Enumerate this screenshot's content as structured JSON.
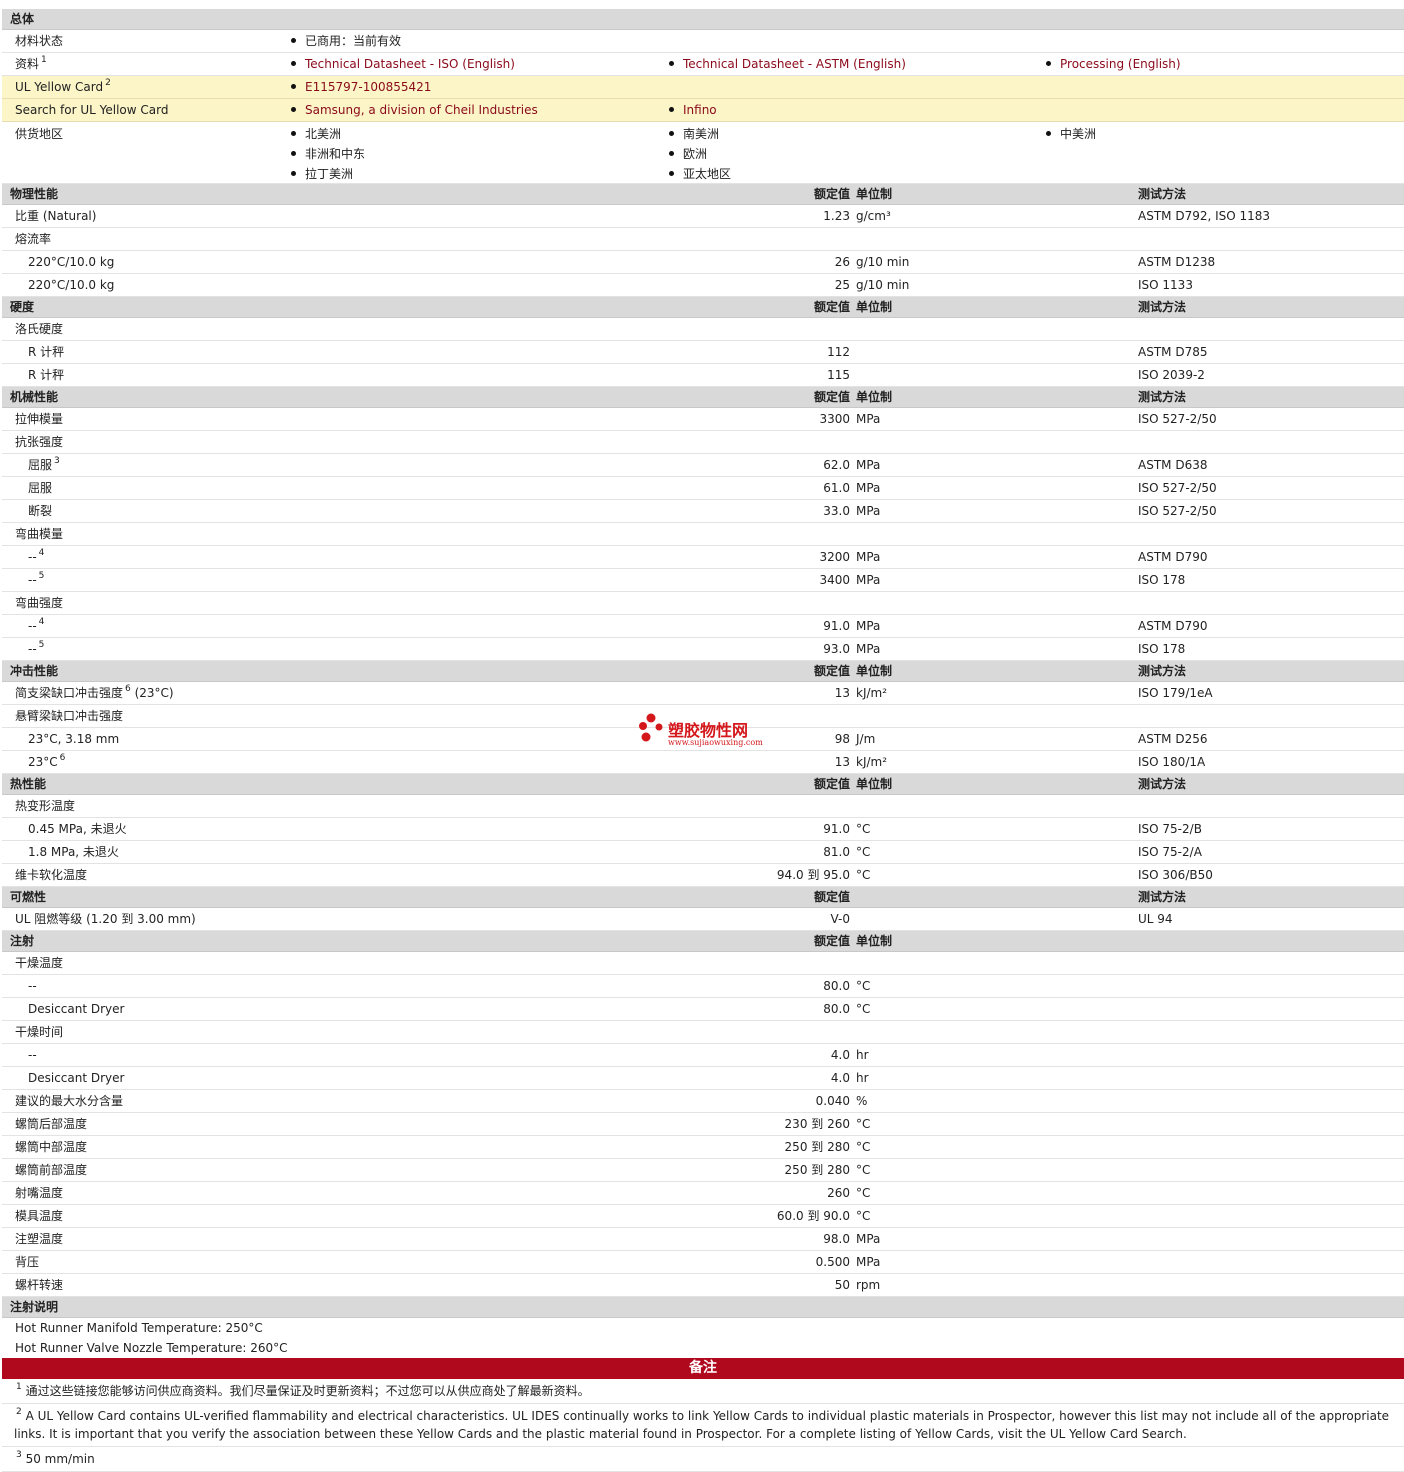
{
  "general": {
    "title": "总体",
    "material_status_label": "材料状态",
    "material_status_value": "已商用：当前有效",
    "docs_label": "资料",
    "docs_sup": "1",
    "docs": [
      "Technical Datasheet - ISO (English)",
      "Technical Datasheet - ASTM (English)",
      "Processing (English)"
    ],
    "ulcard_label": "UL Yellow Card",
    "ulcard_sup": "2",
    "ulcard_value": "E115797-100855421",
    "search_label": "Search for UL Yellow Card",
    "search_values": [
      "Samsung, a division of Cheil Industries",
      "Infino"
    ],
    "supply_label": "供货地区",
    "supply_col1": [
      "北美洲",
      "非洲和中东",
      "拉丁美洲"
    ],
    "supply_col2": [
      "南美洲",
      "欧洲",
      "亚太地区"
    ],
    "supply_col3": [
      "中美洲"
    ]
  },
  "headers": {
    "nominal": "额定值",
    "unit": "单位制",
    "method": "测试方法"
  },
  "physical": {
    "title": "物理性能",
    "rows": [
      {
        "label": "比重  (Natural)",
        "value": "1.23",
        "unit": "g/cm³",
        "method": "ASTM D792, ISO 1183"
      },
      {
        "label": "熔流率",
        "value": "",
        "unit": "",
        "method": ""
      },
      {
        "label": "220°C/10.0 kg",
        "value": "26",
        "unit": "g/10 min",
        "method": "ASTM D1238"
      },
      {
        "label": "220°C/10.0 kg",
        "value": "25",
        "unit": "g/10 min",
        "method": "ISO 1133"
      }
    ]
  },
  "hardness": {
    "title": "硬度",
    "rows": [
      {
        "label": "洛氏硬度",
        "value": "",
        "unit": "",
        "method": ""
      },
      {
        "label": "R 计秤",
        "value": "112",
        "unit": "",
        "method": "ASTM D785"
      },
      {
        "label": "R 计秤",
        "value": "115",
        "unit": "",
        "method": "ISO 2039-2"
      }
    ]
  },
  "mechanical": {
    "title": "机械性能",
    "rows": [
      {
        "label": "拉伸模量",
        "sup": "",
        "value": "3300",
        "unit": "MPa",
        "method": "ISO 527-2/50"
      },
      {
        "label": "抗张强度",
        "sup": "",
        "value": "",
        "unit": "",
        "method": ""
      },
      {
        "label": "屈服",
        "sup": "3",
        "value": "62.0",
        "unit": "MPa",
        "method": "ASTM D638"
      },
      {
        "label": "屈服",
        "sup": "",
        "value": "61.0",
        "unit": "MPa",
        "method": "ISO 527-2/50"
      },
      {
        "label": "断裂",
        "sup": "",
        "value": "33.0",
        "unit": "MPa",
        "method": "ISO 527-2/50"
      },
      {
        "label": "弯曲模量",
        "sup": "",
        "value": "",
        "unit": "",
        "method": ""
      },
      {
        "label": "--",
        "sup": "4",
        "value": "3200",
        "unit": "MPa",
        "method": "ASTM D790"
      },
      {
        "label": "--",
        "sup": "5",
        "value": "3400",
        "unit": "MPa",
        "method": "ISO 178"
      },
      {
        "label": "弯曲强度",
        "sup": "",
        "value": "",
        "unit": "",
        "method": ""
      },
      {
        "label": "--",
        "sup": "4",
        "value": "91.0",
        "unit": "MPa",
        "method": "ASTM D790"
      },
      {
        "label": "--",
        "sup": "5",
        "value": "93.0",
        "unit": "MPa",
        "method": "ISO 178"
      }
    ]
  },
  "impact": {
    "title": "冲击性能",
    "rows": [
      {
        "label": "简支梁缺口冲击强度",
        "sup": "6",
        "suffix": "(23°C)",
        "value": "13",
        "unit": "kJ/m²",
        "method": "ISO 179/1eA"
      },
      {
        "label": "悬臂梁缺口冲击强度",
        "sup": "",
        "suffix": "",
        "value": "",
        "unit": "",
        "method": ""
      },
      {
        "label": "23°C, 3.18 mm",
        "sup": "",
        "suffix": "",
        "value": "98",
        "unit": "J/m",
        "method": "ASTM D256"
      },
      {
        "label": "23°C",
        "sup": "6",
        "suffix": "",
        "value": "13",
        "unit": "kJ/m²",
        "method": "ISO 180/1A"
      }
    ]
  },
  "thermal": {
    "title": "热性能",
    "rows": [
      {
        "label": "热变形温度",
        "value": "",
        "unit": "",
        "method": ""
      },
      {
        "label": "0.45 MPa, 未退火",
        "value": "91.0",
        "unit": "°C",
        "method": "ISO 75-2/B"
      },
      {
        "label": "1.8 MPa, 未退火",
        "value": "81.0",
        "unit": "°C",
        "method": "ISO 75-2/A"
      },
      {
        "label": "维卡软化温度",
        "value": "94.0 到  95.0",
        "unit": "°C",
        "method": "ISO 306/B50"
      }
    ]
  },
  "flammability": {
    "title": "可燃性",
    "rows": [
      {
        "label": "UL 阻燃等级  (1.20 到  3.00 mm)",
        "value": "V-0",
        "unit": "",
        "method": "UL 94"
      }
    ]
  },
  "injection": {
    "title": "注射",
    "rows": [
      {
        "label": "干燥温度",
        "value": "",
        "unit": ""
      },
      {
        "label": "--",
        "value": "80.0",
        "unit": "°C"
      },
      {
        "label": "Desiccant Dryer",
        "value": "80.0",
        "unit": "°C"
      },
      {
        "label": "干燥时间",
        "value": "",
        "unit": ""
      },
      {
        "label": "--",
        "value": "4.0",
        "unit": "hr"
      },
      {
        "label": "Desiccant Dryer",
        "value": "4.0",
        "unit": "hr"
      },
      {
        "label": "建议的最大水分含量",
        "value": "0.040",
        "unit": "%"
      },
      {
        "label": "螺筒后部温度",
        "value": "230 到  260",
        "unit": "°C"
      },
      {
        "label": "螺筒中部温度",
        "value": "250 到  280",
        "unit": "°C"
      },
      {
        "label": "螺筒前部温度",
        "value": "250 到  280",
        "unit": "°C"
      },
      {
        "label": "射嘴温度",
        "value": "260",
        "unit": "°C"
      },
      {
        "label": "模具温度",
        "value": "60.0 到  90.0",
        "unit": "°C"
      },
      {
        "label": "注塑温度",
        "value": "98.0",
        "unit": "MPa"
      },
      {
        "label": "背压",
        "value": "0.500",
        "unit": "MPa"
      },
      {
        "label": "螺杆转速",
        "value": "50",
        "unit": "rpm"
      }
    ]
  },
  "injection_notes": {
    "title": "注射说明",
    "lines": [
      "Hot Runner Manifold Temperature: 250°C",
      "Hot Runner Valve Nozzle Temperature: 260°C"
    ]
  },
  "footnotes": {
    "title": "备注",
    "items": [
      {
        "num": "1",
        "text": "通过这些链接您能够访问供应商资料。我们尽量保证及时更新资料；不过您可以从供应商处了解最新资料。"
      },
      {
        "num": "2",
        "text": "A UL Yellow Card contains UL-verified flammability and electrical characteristics. UL IDES continually works to link Yellow Cards to individual plastic materials in Prospector, however this list may not include all of the appropriate links. It is important that you verify the association between these Yellow Cards and the plastic material found in Prospector. For a complete listing of Yellow Cards, visit the UL Yellow Card Search."
      },
      {
        "num": "3",
        "text": "50 mm/min"
      }
    ]
  },
  "watermark": {
    "text": "塑胶物性网",
    "url": "www.sujiaowuxing.com"
  },
  "colors": {
    "link": "#8b0a1a",
    "section_bg": "#d9d9d9",
    "ul_bg": "#fbf5c8",
    "notes_bar": "#b0091e"
  }
}
